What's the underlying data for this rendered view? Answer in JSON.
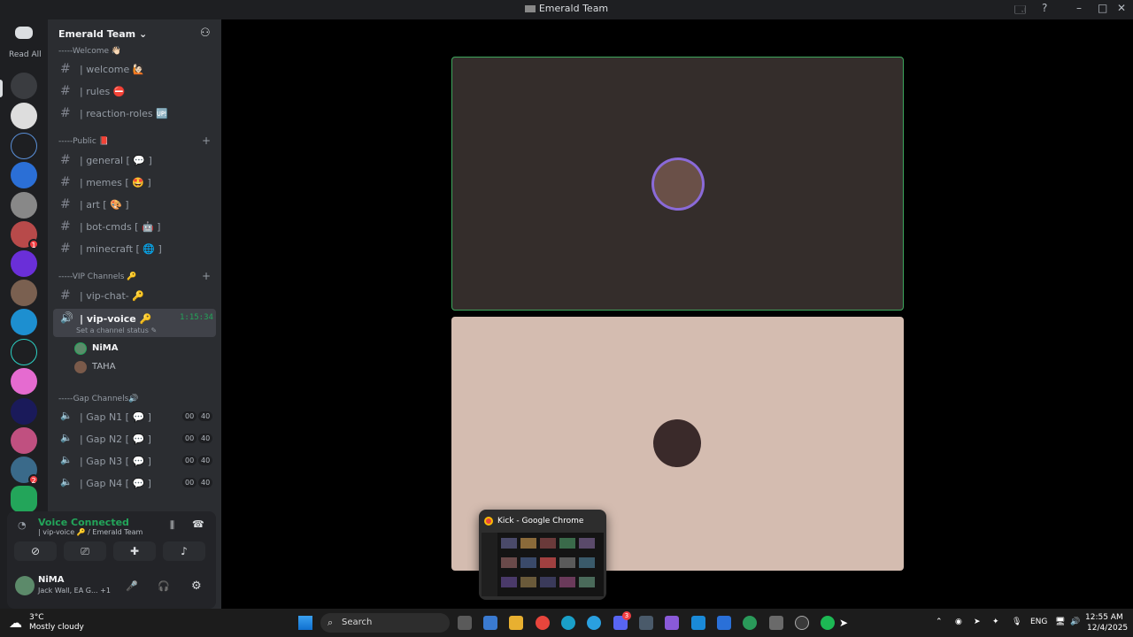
{
  "window": {
    "title": "Emerald Team"
  },
  "server_rail": {
    "read_all": "Read All",
    "badges": [
      "1",
      "2"
    ]
  },
  "guild": {
    "name": "Emerald Team",
    "categories": [
      {
        "label": "-----Welcome 👋🏻",
        "channels": [
          "| welcome 🙋🏻",
          "| rules ⛔",
          "| reaction-roles 🆙"
        ]
      },
      {
        "label": "-----Public 📕",
        "channels": [
          "| general [ 💬 ]",
          "| memes [ 🤩 ]",
          "| art [ 🎨 ]",
          "| bot-cmds [ 🤖 ]",
          "| minecraft [ 🌐 ]"
        ]
      },
      {
        "label": "-----VIP Channels 🔑",
        "channels": [
          "| vip-chat- 🔑"
        ]
      },
      {
        "label": "-----Gap Channels🔊",
        "channels": [
          {
            "label": "| Gap N1 [ 💬 ]",
            "count_a": "00",
            "count_b": "40"
          },
          {
            "label": "| Gap N2 [ 💬 ]",
            "count_a": "00",
            "count_b": "40"
          },
          {
            "label": "| Gap N3 [ 💬 ]",
            "count_a": "00",
            "count_b": "40"
          },
          {
            "label": "| Gap N4 [ 💬 ]",
            "count_a": "00",
            "count_b": "40"
          }
        ]
      }
    ],
    "voice_channel": {
      "label": "| vip-voice 🔑",
      "timer": "1:15:34",
      "status": "Set a channel status ✎"
    },
    "voice_users": [
      "NiMA",
      "TAHA"
    ]
  },
  "voice_panel": {
    "title": "Voice Connected",
    "subtitle": "| vip-voice 🔑 / Emerald Team"
  },
  "me": {
    "name": "NiMA",
    "status": "Jack Wall, EA G...",
    "extra": "+1"
  },
  "preview": {
    "title": "Kick - Google Chrome"
  },
  "taskbar": {
    "weather_temp": "3°C",
    "weather_desc": "Mostly cloudy",
    "search": "Search",
    "lang": "ENG",
    "time": "12:55 AM",
    "date": "12/4/2025",
    "discord_badge": "3"
  },
  "colors": {
    "green": "#23a55a",
    "tile_border": "#3ea75d"
  }
}
